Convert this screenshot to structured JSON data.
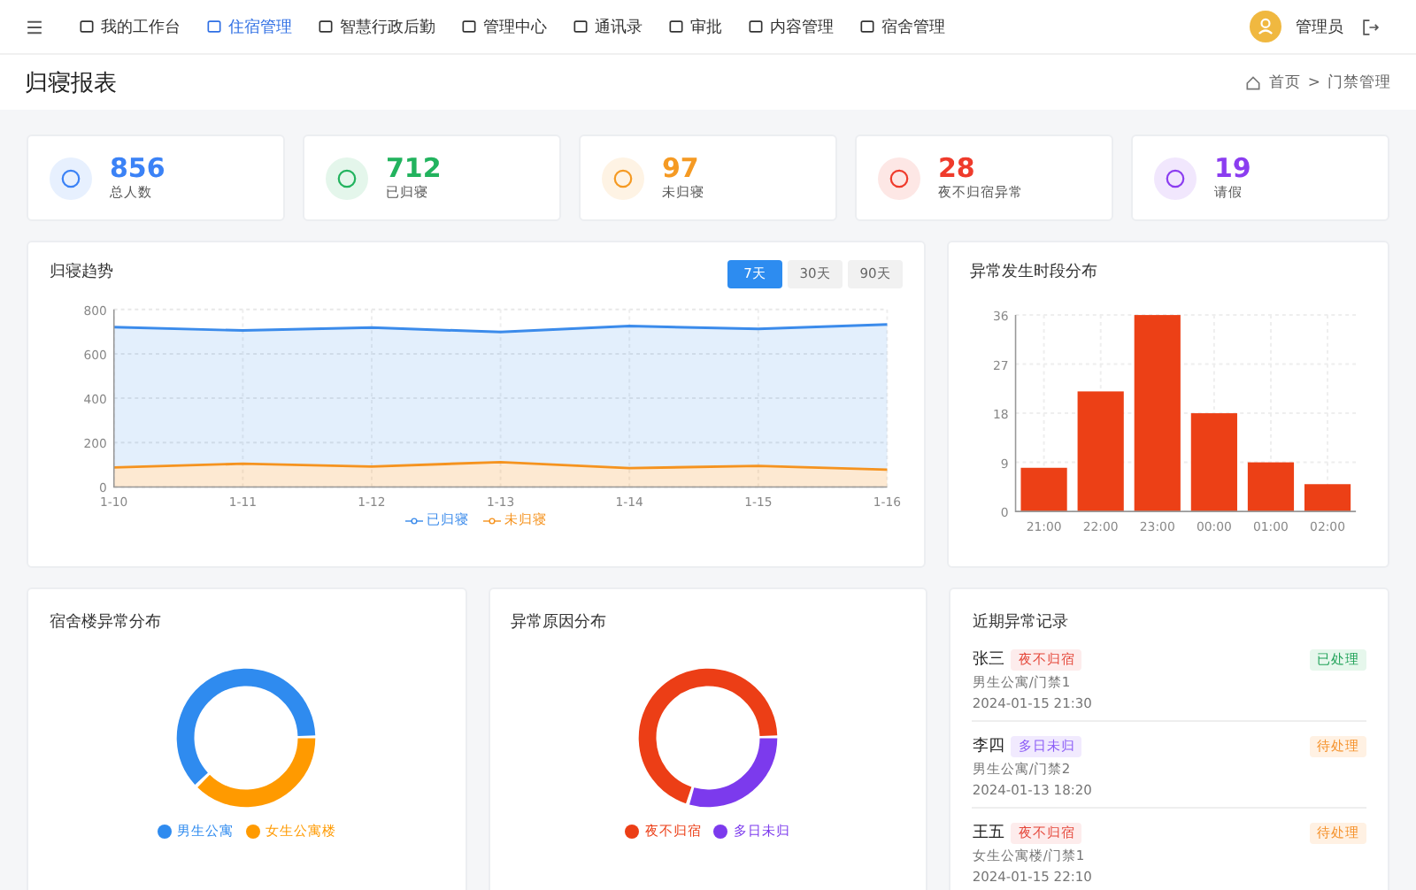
{
  "nav": {
    "items": [
      {
        "label": "我的工作台",
        "selected": false
      },
      {
        "label": "住宿管理",
        "selected": true
      },
      {
        "label": "智慧行政后勤",
        "selected": false
      },
      {
        "label": "管理中心",
        "selected": false
      },
      {
        "label": "通讯录",
        "selected": false
      },
      {
        "label": "审批",
        "selected": false
      },
      {
        "label": "内容管理",
        "selected": false
      },
      {
        "label": "宿舍管理",
        "selected": false
      }
    ],
    "user": "管理员"
  },
  "page": {
    "title": "归寝报表",
    "breadcrumb": [
      "首页",
      ">",
      "门禁管理"
    ]
  },
  "stats": [
    {
      "value": "856",
      "label": "总人数",
      "color": "#3b82f6"
    },
    {
      "value": "712",
      "label": "已归寝",
      "color": "#22b35e"
    },
    {
      "value": "97",
      "label": "未归寝",
      "color": "#f59a23"
    },
    {
      "value": "28",
      "label": "夜不归宿异常",
      "color": "#ef3b2c"
    },
    {
      "value": "19",
      "label": "请假",
      "color": "#8b3df0"
    }
  ],
  "trend": {
    "title": "归寝趋势",
    "ranges": [
      {
        "label": "7天",
        "selected": true
      },
      {
        "label": "30天",
        "selected": false
      },
      {
        "label": "90天",
        "selected": false
      }
    ],
    "chart_data": {
      "type": "area",
      "grid": true,
      "x": [
        "1-10",
        "1-11",
        "1-12",
        "1-13",
        "1-14",
        "1-15",
        "1-16"
      ],
      "ylim": [
        0,
        800
      ],
      "yticks": [
        0,
        200,
        400,
        600,
        800
      ],
      "series": [
        {
          "name": "已归寝",
          "color": "#3b8beb",
          "values": [
            720,
            705,
            718,
            698,
            725,
            712,
            732
          ]
        },
        {
          "name": "未归寝",
          "color": "#f5931f",
          "values": [
            88,
            105,
            92,
            112,
            85,
            95,
            78
          ]
        }
      ]
    }
  },
  "hourly": {
    "title": "异常发生时段分布",
    "chart_data": {
      "type": "bar",
      "grid": true,
      "categories": [
        "21:00",
        "22:00",
        "23:00",
        "00:00",
        "01:00",
        "02:00"
      ],
      "ylim": [
        0,
        36
      ],
      "yticks": [
        0,
        9,
        18,
        27,
        36
      ],
      "series": [
        {
          "color": "#ec4016",
          "values": [
            8,
            22,
            36,
            18,
            9,
            5
          ]
        }
      ]
    }
  },
  "buildings": {
    "title": "宿舍楼异常分布",
    "legend": [
      {
        "label": "男生公寓",
        "color": "#2f8bef"
      },
      {
        "label": "女生公寓楼",
        "color": "#ff9a00"
      }
    ]
  },
  "reasons": {
    "title": "异常原因分布",
    "legend": [
      {
        "label": "夜不归宿",
        "color": "#ec3e16"
      },
      {
        "label": "多日未归",
        "color": "#7c3aed"
      }
    ]
  },
  "records": {
    "title": "近期异常记录",
    "items": [
      {
        "name": "张三",
        "tag": {
          "label": "夜不归宿",
          "kind": "night"
        },
        "location": "男生公寓/门禁1",
        "time": "2024-01-15 21:30",
        "status": {
          "label": "已处理",
          "kind": "done"
        }
      },
      {
        "name": "李四",
        "tag": {
          "label": "多日未归",
          "kind": "days"
        },
        "location": "男生公寓/门禁2",
        "time": "2024-01-13 18:20",
        "status": {
          "label": "待处理",
          "kind": "pending"
        }
      },
      {
        "name": "王五",
        "tag": {
          "label": "夜不归宿",
          "kind": "night"
        },
        "location": "女生公寓楼/门禁1",
        "time": "2024-01-15 22:10",
        "status": {
          "label": "待处理",
          "kind": "pending"
        }
      }
    ]
  }
}
